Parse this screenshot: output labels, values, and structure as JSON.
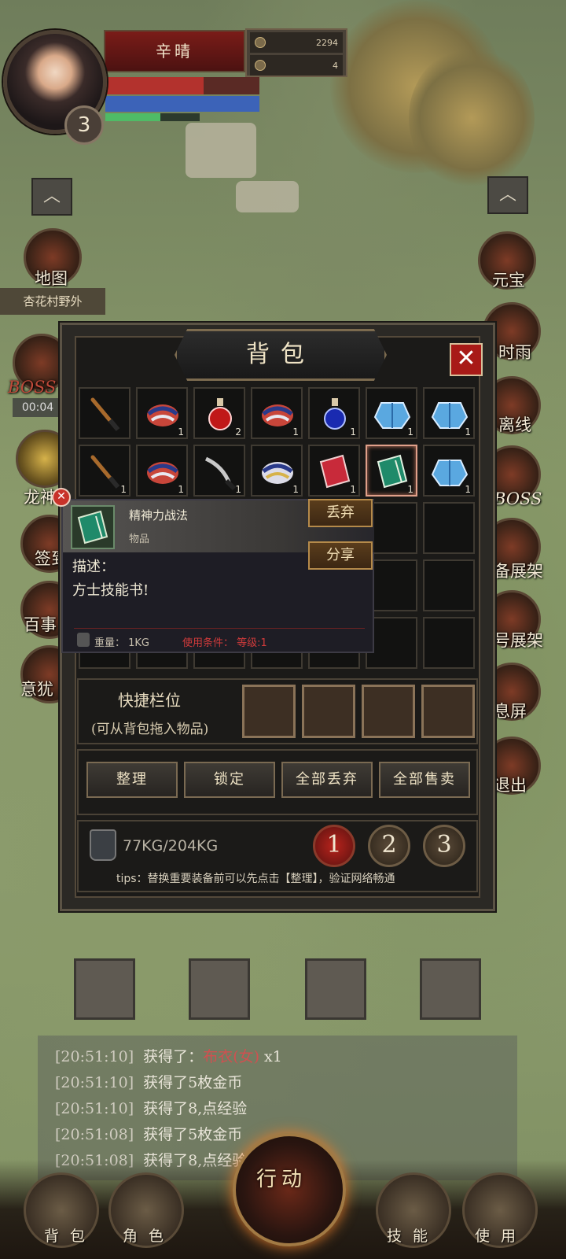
{
  "player": {
    "name": "辛晴",
    "level": "3",
    "currency1": "2294",
    "currency2": "4",
    "hp_fraction": 0.64,
    "mp_fraction": 1.0,
    "xp_fraction": 0.58
  },
  "left_menu": {
    "map_label": "地图",
    "location": "杏花村野外",
    "boss_label": "BOSS",
    "boss_timer": "00:04",
    "dragon_label": "龙神",
    "sign_label": "签到",
    "event_label": "百事",
    "feature_label": "意犹"
  },
  "right_menu": {
    "yuanbao": "元宝",
    "rain": "时雨",
    "offline": "离线",
    "boss": "BOSS",
    "rack": "备展架",
    "rack2": "号展架",
    "screen": "息屏",
    "exit": "退出"
  },
  "bag": {
    "title": "背包",
    "close": "✕",
    "grid": [
      {
        "icon": "sword-icon",
        "qty": ""
      },
      {
        "icon": "red-armor-icon",
        "qty": "1"
      },
      {
        "icon": "red-potion-icon",
        "qty": "2"
      },
      {
        "icon": "red-armor-icon",
        "qty": "1"
      },
      {
        "icon": "blue-potion-icon",
        "qty": "1"
      },
      {
        "icon": "blue-robe-icon",
        "qty": "1"
      },
      {
        "icon": "blue-robe-icon",
        "qty": "1"
      },
      {
        "icon": "sword-icon",
        "qty": "1"
      },
      {
        "icon": "red-armor-icon",
        "qty": "1"
      },
      {
        "icon": "blade-icon",
        "qty": "1"
      },
      {
        "icon": "blue-armor-icon",
        "qty": "1"
      },
      {
        "icon": "red-book-icon",
        "qty": "1"
      },
      {
        "icon": "green-book-icon",
        "qty": "1"
      },
      {
        "icon": "blue-robe-icon",
        "qty": "1"
      }
    ],
    "quick_label": "快捷栏位",
    "quick_hint": "(可从背包拖入物品)",
    "actions": [
      "整理",
      "锁定",
      "全部丢弃",
      "全部售卖"
    ],
    "weight": "77KG/204KG",
    "pages": [
      "1",
      "2",
      "3"
    ],
    "tips": "tips：替换重要装备前可以先点击【整理】，验证网络畅通"
  },
  "tooltip": {
    "item_name": "精神力战法",
    "item_type": "物品",
    "discard": "丢弃",
    "share": "分享",
    "desc_label": "描述：",
    "desc": "方士技能书!",
    "weight": "重量： 1KG",
    "requirement": "使用条件： 等级:1"
  },
  "chat": [
    {
      "time": "[20:51:10]",
      "text": "获得了：",
      "highlight": "布衣(女)",
      "suffix": " x1"
    },
    {
      "time": "[20:51:10]",
      "text": "获得了5枚金币"
    },
    {
      "time": "[20:51:10]",
      "text": "获得了8,点经验"
    },
    {
      "time": "[20:51:08]",
      "text": "获得了5枚金币"
    },
    {
      "time": "[20:51:08]",
      "text": "获得了8,点经验"
    }
  ],
  "nav": {
    "bag": "背包",
    "role": "角色",
    "action": "行动",
    "skill": "技能",
    "use": "使用"
  },
  "colors": {
    "accent_red": "#a81a17",
    "gold": "#b58a4a",
    "requirement_red": "#d23b3b"
  }
}
